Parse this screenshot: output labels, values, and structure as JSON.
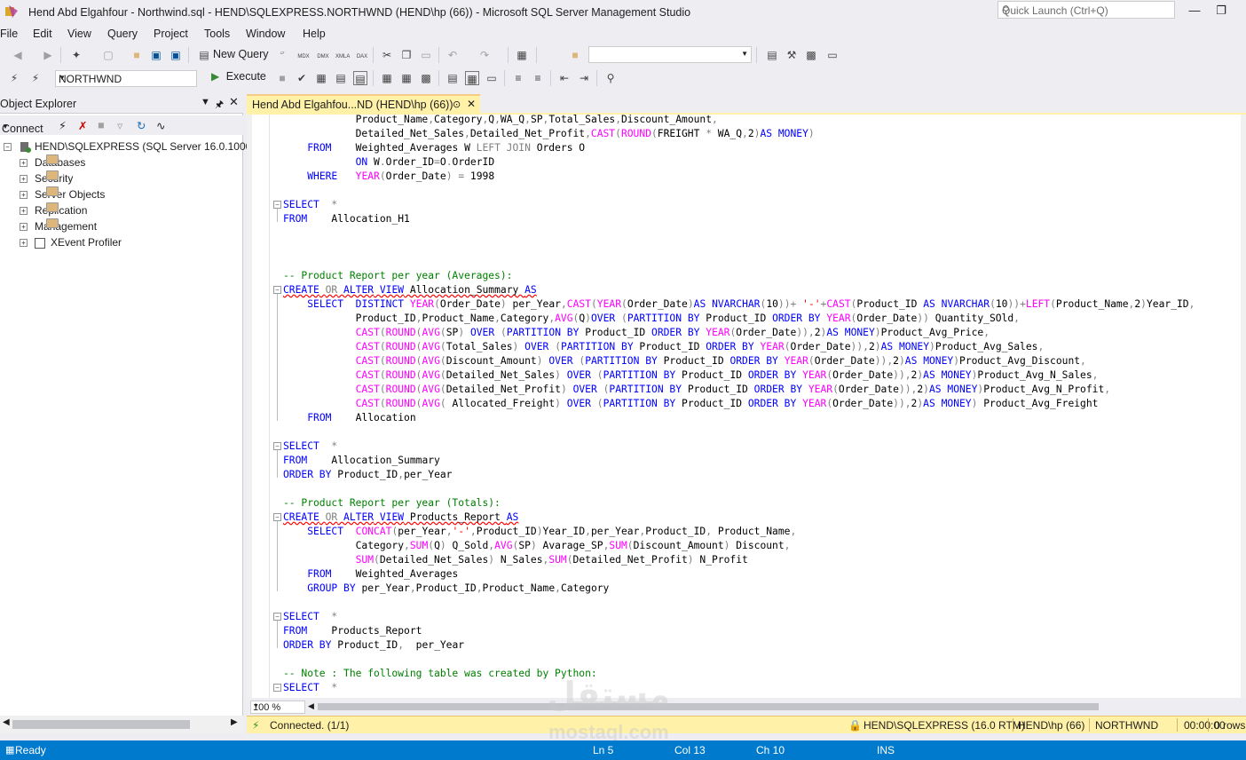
{
  "window": {
    "title": "Hend Abd Elgahfour - Northwind.sql - HEND\\SQLEXPRESS.NORTHWND (HEND\\hp (66)) - Microsoft SQL Server Management Studio",
    "quick_launch_placeholder": "Quick Launch (Ctrl+Q)"
  },
  "menu": [
    "File",
    "Edit",
    "View",
    "Query",
    "Project",
    "Tools",
    "Window",
    "Help"
  ],
  "toolbar": {
    "new_query": "New Query",
    "database": "NORTHWND",
    "execute": "Execute",
    "icon_labels": [
      "MDX",
      "DMX",
      "XMLA",
      "DAX"
    ]
  },
  "object_explorer": {
    "title": "Object Explorer",
    "connect": "Connect",
    "server": "HEND\\SQLEXPRESS (SQL Server 16.0.1000 - H",
    "nodes": [
      "Databases",
      "Security",
      "Server Objects",
      "Replication",
      "Management",
      "XEvent Profiler"
    ]
  },
  "tab": {
    "title": "Hend Abd Elgahfou...ND (HEND\\hp (66))"
  },
  "editor": {
    "zoom": "100 %"
  },
  "query_status": {
    "connected": "Connected. (1/1)",
    "server": "HEND\\SQLEXPRESS (16.0 RTM)",
    "user": "HEND\\hp (66)",
    "database": "NORTHWND",
    "time": "00:00:00",
    "rows": "0 rows"
  },
  "status": {
    "ready": "Ready",
    "ln": "Ln 5",
    "col": "Col 13",
    "ch": "Ch 10",
    "ins": "INS"
  },
  "watermark": {
    "arabic": "مستقل",
    "latin": "mostaql.com"
  },
  "colors": {
    "accent": "#007acc",
    "tab_active": "#fff1a8",
    "keyword": "#0000ff",
    "function": "#ff00ff",
    "comment": "#008000"
  }
}
